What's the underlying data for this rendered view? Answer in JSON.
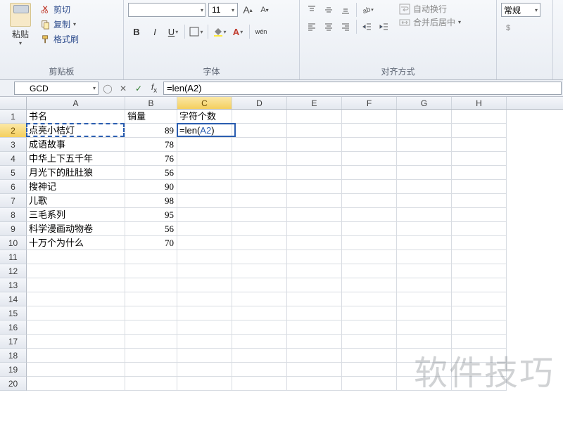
{
  "ribbon": {
    "paste_label": "粘贴",
    "cut_label": "剪切",
    "copy_label": "复制",
    "format_painter_label": "格式刷",
    "clipboard_title": "剪贴板",
    "font_size": "11",
    "bold": "B",
    "italic": "I",
    "underline": "U",
    "font_title": "字体",
    "wrap_label": "自动换行",
    "merge_label": "合并后居中",
    "align_title": "对齐方式",
    "number_format": "常规"
  },
  "formula_bar": {
    "name_box": "GCD",
    "formula": "=len(A2)"
  },
  "columns": [
    "A",
    "B",
    "C",
    "D",
    "E",
    "F",
    "G",
    "H"
  ],
  "col_widths": {
    "A": 140,
    "B": 74,
    "C": 78,
    "D": 78,
    "E": 78,
    "F": 78,
    "G": 78,
    "H": 78
  },
  "headers": {
    "A": "书名",
    "B": "销量",
    "C": "字符个数"
  },
  "rows": [
    {
      "A": "点亮小桔灯",
      "B": 89
    },
    {
      "A": "成语故事",
      "B": 78
    },
    {
      "A": "中华上下五千年",
      "B": 76
    },
    {
      "A": "月光下的肚肚狼",
      "B": 56
    },
    {
      "A": "搜神记",
      "B": 90
    },
    {
      "A": "儿歌",
      "B": 98
    },
    {
      "A": "三毛系列",
      "B": 95
    },
    {
      "A": "科学漫画动物卷",
      "B": 56
    },
    {
      "A": "十万个为什么",
      "B": 70
    }
  ],
  "total_rows": 20,
  "editing_cell": {
    "row": 2,
    "col": "C",
    "text_prefix": "=len(",
    "ref": "A2",
    "text_suffix": ")"
  },
  "marching_ants_cell": {
    "row": 2,
    "col": "A"
  },
  "watermark": "软件技巧"
}
